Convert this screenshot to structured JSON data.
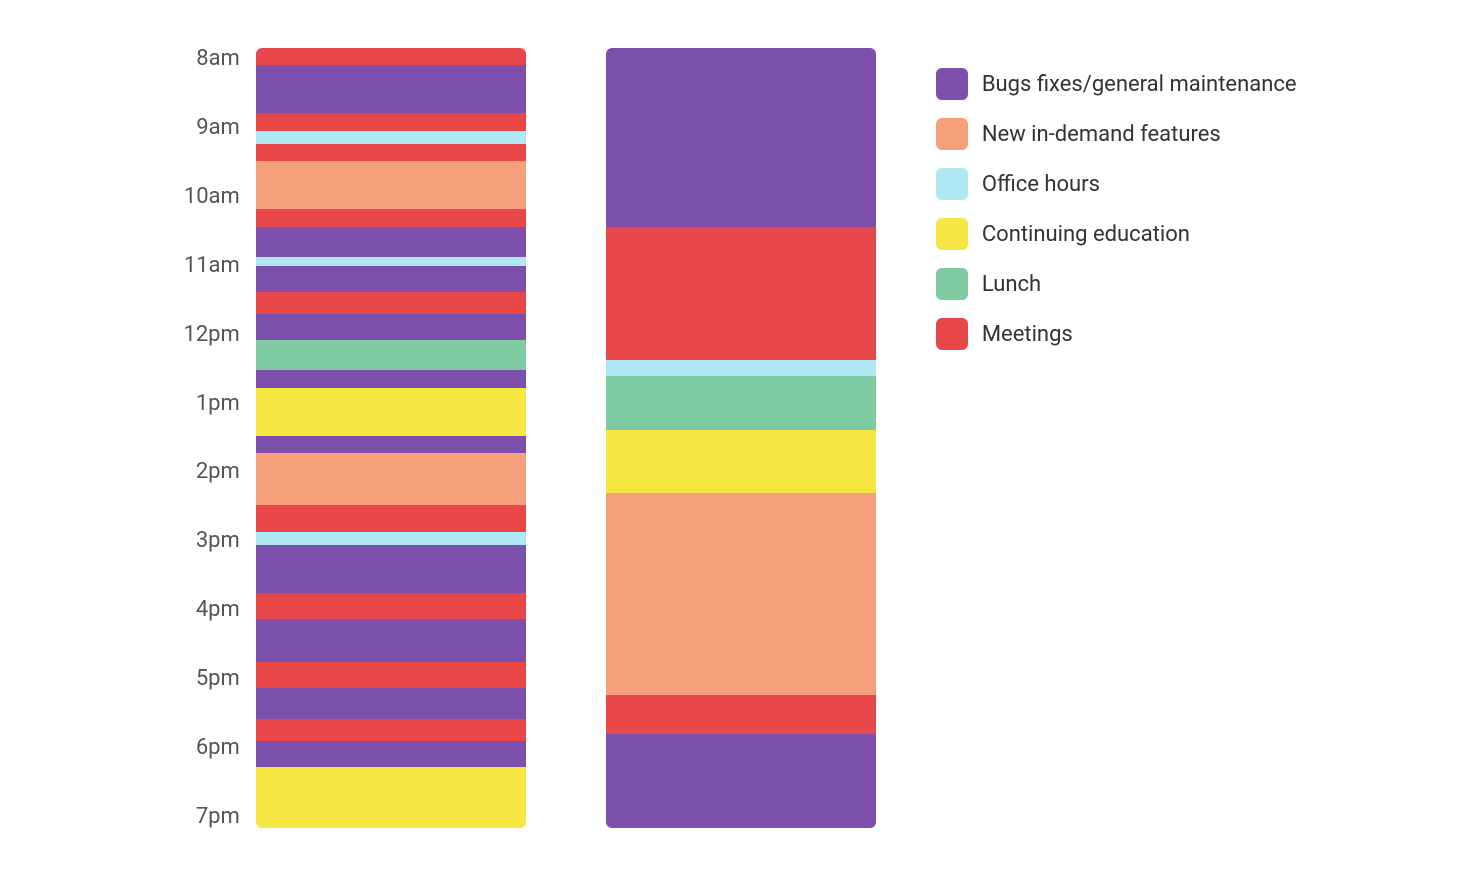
{
  "yAxis": {
    "labels": [
      "8am",
      "9am",
      "10am",
      "11am",
      "12pm",
      "1pm",
      "2pm",
      "3pm",
      "4pm",
      "5pm",
      "6pm",
      "7pm"
    ]
  },
  "colors": {
    "bugs": "#7B4FAB",
    "newFeatures": "#F5A07A",
    "officeHours": "#ADE8F4",
    "continuingEd": "#F5E642",
    "lunch": "#7ECBA1",
    "meetings": "#E8484A"
  },
  "bar1": {
    "segments": [
      {
        "category": "meetings",
        "heightPct": 2.0,
        "color": "#E8484A"
      },
      {
        "category": "bugs",
        "heightPct": 5.5,
        "color": "#7B4FAB"
      },
      {
        "category": "meetings",
        "heightPct": 2.0,
        "color": "#E8484A"
      },
      {
        "category": "officeHours",
        "heightPct": 1.5,
        "color": "#ADE8F4"
      },
      {
        "category": "meetings",
        "heightPct": 2.0,
        "color": "#E8484A"
      },
      {
        "category": "newFeatures",
        "heightPct": 5.5,
        "color": "#F5A07A"
      },
      {
        "category": "meetings",
        "heightPct": 2.0,
        "color": "#E8484A"
      },
      {
        "category": "bugs",
        "heightPct": 3.5,
        "color": "#7B4FAB"
      },
      {
        "category": "officeHours",
        "heightPct": 1.0,
        "color": "#ADE8F4"
      },
      {
        "category": "bugs",
        "heightPct": 3.0,
        "color": "#7B4FAB"
      },
      {
        "category": "meetings",
        "heightPct": 2.5,
        "color": "#E8484A"
      },
      {
        "category": "bugs",
        "heightPct": 3.0,
        "color": "#7B4FAB"
      },
      {
        "category": "lunch",
        "heightPct": 3.5,
        "color": "#7ECBA1"
      },
      {
        "category": "bugs",
        "heightPct": 2.0,
        "color": "#7B4FAB"
      },
      {
        "category": "continuingEd",
        "heightPct": 5.5,
        "color": "#F5E642"
      },
      {
        "category": "bugs",
        "heightPct": 2.0,
        "color": "#7B4FAB"
      },
      {
        "category": "newFeatures",
        "heightPct": 6.0,
        "color": "#F5A07A"
      },
      {
        "category": "meetings",
        "heightPct": 3.0,
        "color": "#E8484A"
      },
      {
        "category": "officeHours",
        "heightPct": 1.5,
        "color": "#ADE8F4"
      },
      {
        "category": "bugs",
        "heightPct": 5.5,
        "color": "#7B4FAB"
      },
      {
        "category": "meetings",
        "heightPct": 3.0,
        "color": "#E8484A"
      },
      {
        "category": "bugs",
        "heightPct": 5.0,
        "color": "#7B4FAB"
      },
      {
        "category": "meetings",
        "heightPct": 3.0,
        "color": "#E8484A"
      },
      {
        "category": "bugs",
        "heightPct": 3.5,
        "color": "#7B4FAB"
      },
      {
        "category": "meetings",
        "heightPct": 2.5,
        "color": "#E8484A"
      },
      {
        "category": "bugs",
        "heightPct": 3.0,
        "color": "#7B4FAB"
      },
      {
        "category": "continuingEd",
        "heightPct": 7.0,
        "color": "#F5E642"
      }
    ]
  },
  "bar2": {
    "segments": [
      {
        "category": "bugs",
        "heightPct": 23,
        "color": "#7B4FAB"
      },
      {
        "category": "meetings",
        "heightPct": 17,
        "color": "#E8484A"
      },
      {
        "category": "officeHours",
        "heightPct": 2,
        "color": "#ADE8F4"
      },
      {
        "category": "lunch",
        "heightPct": 7,
        "color": "#7ECBA1"
      },
      {
        "category": "continuingEd",
        "heightPct": 8,
        "color": "#F5E642"
      },
      {
        "category": "newFeatures",
        "heightPct": 26,
        "color": "#F5A07A"
      },
      {
        "category": "meetings",
        "heightPct": 5,
        "color": "#E8484A"
      },
      {
        "category": "bugs",
        "heightPct": 12,
        "color": "#7B4FAB"
      }
    ]
  },
  "legend": {
    "items": [
      {
        "label": "Bugs fixes/general maintenance",
        "color": "#7B4FAB",
        "name": "bugs"
      },
      {
        "label": "New in-demand features",
        "color": "#F5A07A",
        "name": "new-features"
      },
      {
        "label": "Office hours",
        "color": "#ADE8F4",
        "name": "office-hours"
      },
      {
        "label": "Continuing education",
        "color": "#F5E642",
        "name": "continuing-education"
      },
      {
        "label": "Lunch",
        "color": "#7ECBA1",
        "name": "lunch"
      },
      {
        "label": "Meetings",
        "color": "#E8484A",
        "name": "meetings"
      }
    ]
  }
}
